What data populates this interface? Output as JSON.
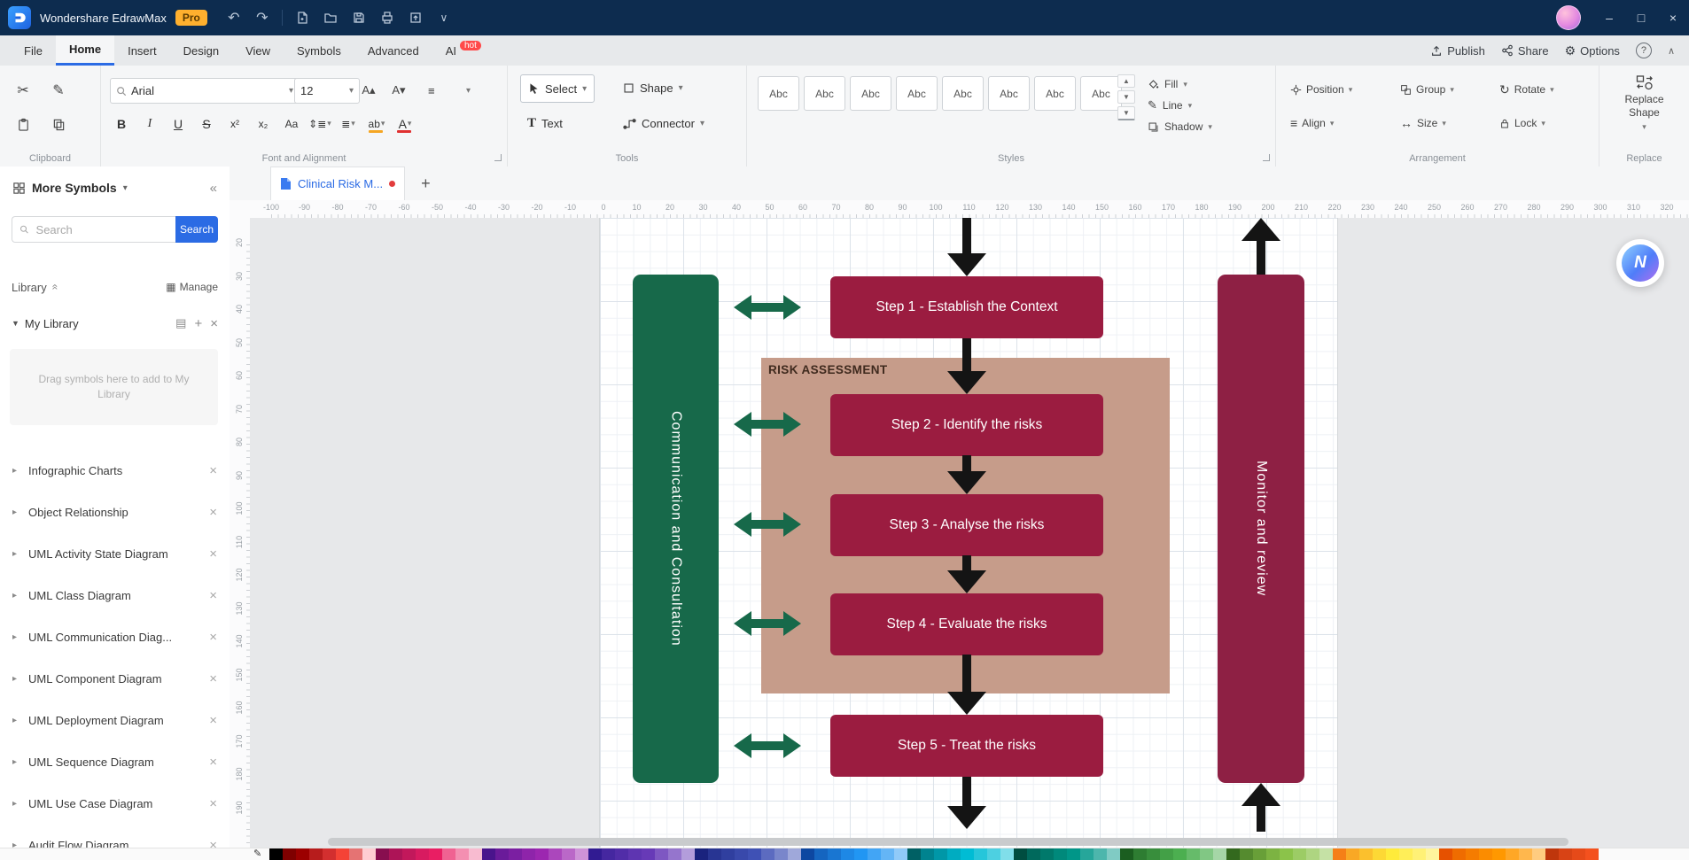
{
  "titlebar": {
    "app_title": "Wondershare EdrawMax",
    "pro_badge": "Pro",
    "icons": {
      "undo": "↶",
      "redo": "↷",
      "more": "∨",
      "min": "–",
      "max": "□",
      "close": "×"
    }
  },
  "menubar": {
    "items": [
      {
        "label": "File"
      },
      {
        "label": "Home",
        "active": true
      },
      {
        "label": "Insert"
      },
      {
        "label": "Design"
      },
      {
        "label": "View"
      },
      {
        "label": "Symbols"
      },
      {
        "label": "Advanced"
      },
      {
        "label": "AI",
        "badge": "hot"
      }
    ],
    "publish": "Publish",
    "share": "Share",
    "options": "Options",
    "help": "?",
    "collapse": "∧",
    "options_icon": "⚙"
  },
  "ribbon": {
    "font_name": "Arial",
    "font_size": "12",
    "group_labels": {
      "clipboard": "Clipboard",
      "font": "Font and Alignment",
      "tools": "Tools",
      "styles": "Styles",
      "arrangement": "Arrangement",
      "replace": "Replace"
    },
    "tool_labels": {
      "select": "Select",
      "shape": "Shape",
      "text": "Text",
      "connector": "Connector"
    },
    "style_items": [
      "Abc",
      "Abc",
      "Abc",
      "Abc",
      "Abc",
      "Abc",
      "Abc",
      "Abc"
    ],
    "fill": "Fill",
    "line": "Line",
    "shadow": "Shadow",
    "position": "Position",
    "group": "Group",
    "rotate": "Rotate",
    "align": "Align",
    "size": "Size",
    "lock": "Lock",
    "replace_shape": "Replace Shape",
    "fmt": {
      "bold": "B",
      "italic": "I",
      "underline": "U",
      "strike": "S",
      "sup": "x²",
      "sub": "x₂",
      "case": "Aa",
      "spacing": "⇕≣",
      "list": "≣",
      "highlight": "ab",
      "fontcolor": "A",
      "alignicon": "≡",
      "grow": "A▴",
      "shrink": "A▾",
      "scissors": "✂",
      "painter": "✎",
      "rotate_icon": "↻",
      "align_icon": "≡",
      "size_icon": "↔"
    }
  },
  "sidebar": {
    "title": "More Symbols",
    "collapse_icon": "«",
    "search_placeholder": "Search",
    "search_button": "Search",
    "library_label": "Library",
    "manage_label": "Manage",
    "manage_icon": "▦",
    "my_library": "My Library",
    "mylib_icons": {
      "list": "▤",
      "add": "+",
      "close": "×"
    },
    "drop_hint": "Drag symbols here to add to My Library",
    "libraries": [
      "Infographic Charts",
      "Object Relationship",
      "UML Activity State Diagram",
      "UML Class Diagram",
      "UML Communication Diag...",
      "UML Component Diagram",
      "UML Deployment Diagram",
      "UML Sequence Diagram",
      "UML Use Case Diagram",
      "Audit Flow Diagram"
    ]
  },
  "canvas": {
    "tab_title": "Clinical Risk M...",
    "tab_add": "+",
    "ruler_h": [
      "-100",
      "-90",
      "-80",
      "-70",
      "-60",
      "-50",
      "-40",
      "-30",
      "-20",
      "-10",
      "0",
      "10",
      "20",
      "30",
      "40",
      "50",
      "60",
      "70",
      "80",
      "90",
      "100",
      "110",
      "120",
      "130",
      "140",
      "150",
      "160",
      "170",
      "180",
      "190",
      "200",
      "210",
      "220",
      "230",
      "240",
      "250",
      "260",
      "270",
      "280",
      "290",
      "300",
      "310",
      "320"
    ],
    "ruler_v": [
      "20",
      "30",
      "40",
      "50",
      "60",
      "70",
      "80",
      "90",
      "100",
      "110",
      "120",
      "130",
      "140",
      "150",
      "160",
      "170",
      "180",
      "190"
    ],
    "diagram": {
      "left_bar": "Communication and Consultation",
      "right_bar": "Monitor and review",
      "risk_label": "RISK ASSESSMENT",
      "steps": [
        "Step 1 - Establish the Context",
        "Step 2 - Identify  the risks",
        "Step 3 - Analyse the risks",
        "Step 4 - Evaluate the risks",
        "Step 5 - Treat the risks"
      ]
    },
    "ai_bubble_letter": "N"
  },
  "palette": [
    "#000000",
    "#7f0000",
    "#9c0000",
    "#b71c1c",
    "#d32f2f",
    "#f44336",
    "#e57373",
    "#ffcdd2",
    "#880e4f",
    "#ad1457",
    "#c2185b",
    "#d81b60",
    "#e91e63",
    "#f06292",
    "#f48fb1",
    "#f8bbd0",
    "#4a148c",
    "#6a1b9a",
    "#7b1fa2",
    "#8e24aa",
    "#9c27b0",
    "#ab47bc",
    "#ba68c8",
    "#ce93d8",
    "#311b92",
    "#4527a0",
    "#512da8",
    "#5e35b1",
    "#673ab7",
    "#7e57c2",
    "#9575cd",
    "#b39ddb",
    "#1a237e",
    "#283593",
    "#303f9f",
    "#3949ab",
    "#3f51b5",
    "#5c6bc0",
    "#7986cb",
    "#9fa8da",
    "#0d47a1",
    "#1565c0",
    "#1976d2",
    "#1e88e5",
    "#2196f3",
    "#42a5f5",
    "#64b5f6",
    "#90caf9",
    "#006064",
    "#00838f",
    "#0097a7",
    "#00acc1",
    "#00bcd4",
    "#26c6da",
    "#4dd0e1",
    "#80deea",
    "#004d40",
    "#00695c",
    "#00796b",
    "#00897b",
    "#009688",
    "#26a69a",
    "#4db6ac",
    "#80cbc4",
    "#1b5e20",
    "#2e7d32",
    "#388e3c",
    "#43a047",
    "#4caf50",
    "#66bb6a",
    "#81c784",
    "#a5d6a7",
    "#33691e",
    "#558b2f",
    "#689f38",
    "#7cb342",
    "#8bc34a",
    "#9ccc65",
    "#aed581",
    "#c5e1a5",
    "#f57f17",
    "#f9a825",
    "#fbc02d",
    "#fdd835",
    "#ffeb3b",
    "#ffee58",
    "#fff176",
    "#fff59d",
    "#e65100",
    "#ef6c00",
    "#f57c00",
    "#fb8c00",
    "#ff9800",
    "#ffa726",
    "#ffb74d",
    "#ffcc80",
    "#bf360c",
    "#d84315",
    "#e64a19",
    "#f4511e"
  ],
  "colors": {
    "accent": "#2b6be4",
    "step": "#9b1c40",
    "rightbar": "#8e2044",
    "green": "#17694a",
    "tan": "#c69c8a"
  }
}
